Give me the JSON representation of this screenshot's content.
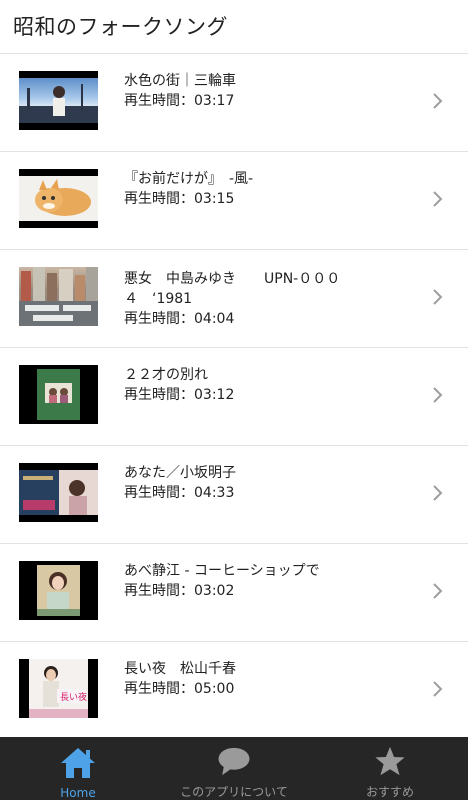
{
  "header": {
    "title": "昭和のフォークソング"
  },
  "duration_prefix": "再生時間：",
  "items": [
    {
      "title": "水色の街｜三輪車",
      "duration": "再生時間：03:17"
    },
    {
      "title": "『お前だけが』　-風-",
      "duration": "再生時間：03:15"
    },
    {
      "title": "悪女　中島みゆき　　UPN-０００\n４　‘1981",
      "duration": "再生時間：04:04"
    },
    {
      "title": "２２才の別れ",
      "duration": "再生時間：03:12"
    },
    {
      "title": "あなた／小坂明子",
      "duration": "再生時間：04:33"
    },
    {
      "title": "あべ静江 - コーヒーショップで",
      "duration": "再生時間：03:02"
    },
    {
      "title": "長い夜　松山千春",
      "duration": "再生時間：05:00"
    }
  ],
  "thumbnails": {
    "0": "anime-girl-sky",
    "1": "kitten",
    "2": "city-street-lyrics",
    "3": "album-cover-green",
    "4": "album-cover-split",
    "5": "woman-portrait",
    "6": "record-cover-nagai-yoru"
  },
  "thumb_text": {
    "6": "長い夜"
  },
  "tabbar": {
    "tabs": [
      {
        "label": "Home",
        "icon": "home-icon",
        "active": true
      },
      {
        "label": "このアプリについて",
        "icon": "speech-bubble-icon",
        "active": false
      },
      {
        "label": "おすすめ",
        "icon": "star-icon",
        "active": false
      }
    ]
  },
  "colors": {
    "accent": "#4ea3e8",
    "tabbar_bg": "#262626",
    "tab_inactive": "#9a9a9a",
    "divider": "#e2e2e2",
    "chevron": "#9e9e9e"
  }
}
